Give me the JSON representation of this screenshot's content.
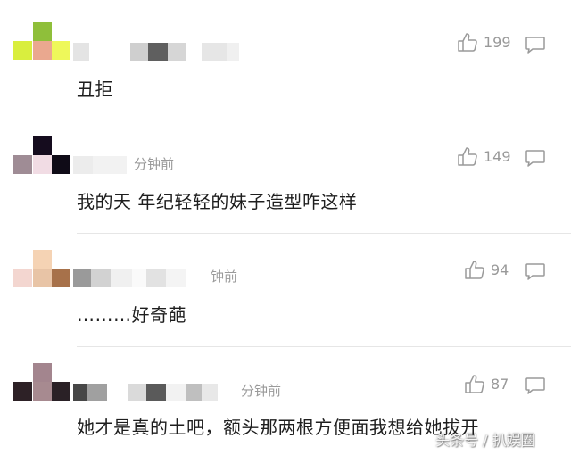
{
  "comments": [
    {
      "time": "",
      "text": "丑拒",
      "likes": "199"
    },
    {
      "time": "分钟前",
      "text": "我的天 年纪轻轻的妹子造型咋这样",
      "likes": "149"
    },
    {
      "time": "钟前",
      "text": "………好奇葩",
      "likes": "94"
    },
    {
      "time": "分钟前",
      "text": "她才是真的土吧，额头那两根方便面我想给她拔开",
      "likes": "87"
    }
  ],
  "icons": {
    "like": "thumbs-up-icon",
    "reply": "comment-bubble-icon"
  },
  "watermark": "头条号 / 扒娱圈"
}
